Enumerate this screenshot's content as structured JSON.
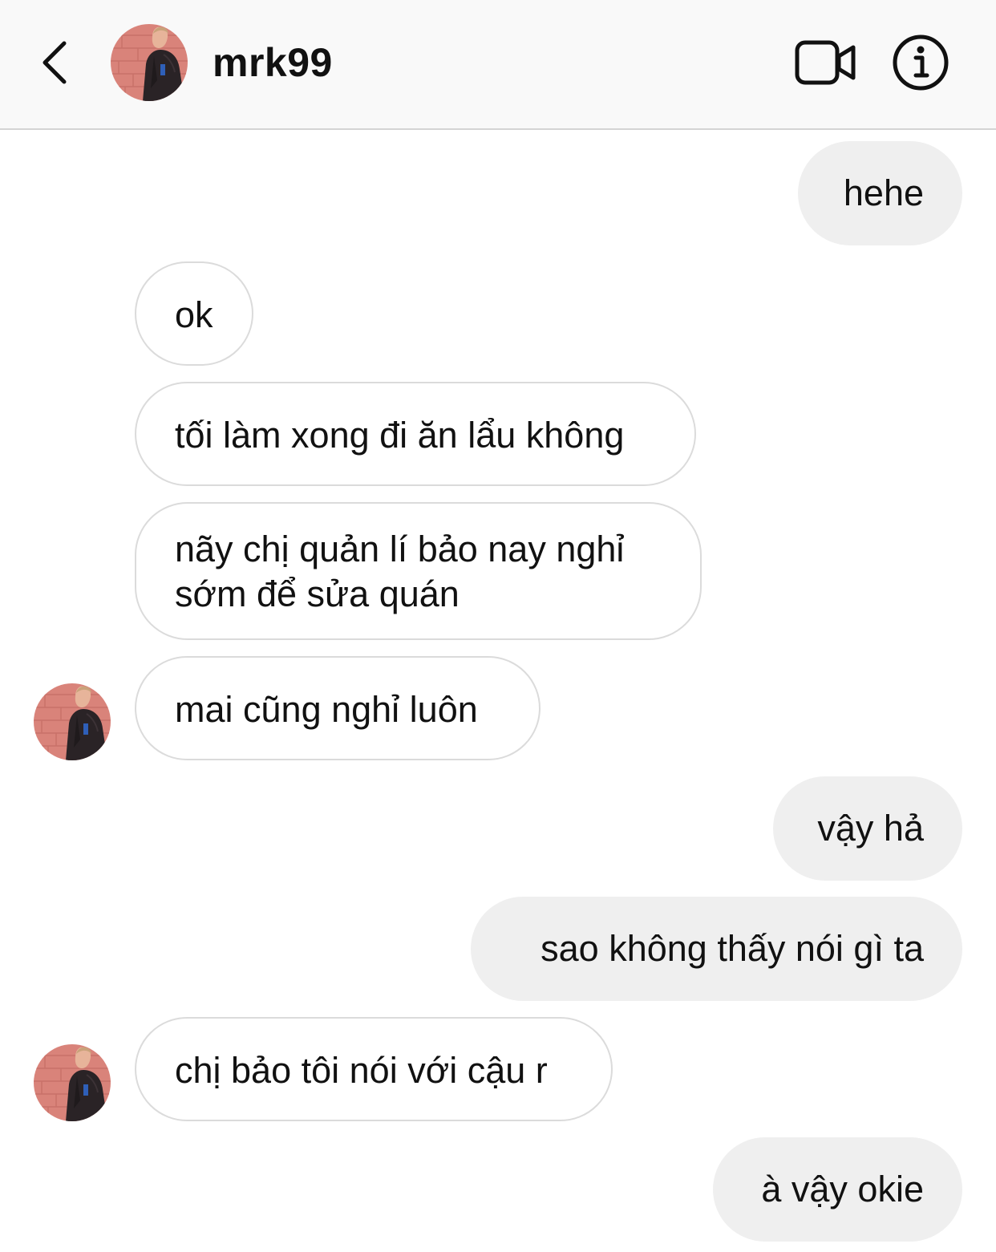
{
  "header": {
    "username": "mrk99",
    "back_icon": "chevron-left-icon",
    "video_icon": "video-camera-icon",
    "info_icon": "info-icon"
  },
  "messages": [
    {
      "from": "me",
      "text": "hehe"
    },
    {
      "from": "them",
      "text": "ok"
    },
    {
      "from": "them",
      "text": "tối làm xong đi ăn lẩu không"
    },
    {
      "from": "them",
      "text": "nãy chị quản lí bảo nay nghỉ sớm để sửa quán"
    },
    {
      "from": "them",
      "text": "mai cũng nghỉ luôn"
    },
    {
      "from": "me",
      "text": "vậy hả"
    },
    {
      "from": "me",
      "text": "sao không thấy nói gì ta"
    },
    {
      "from": "them",
      "text": "chị bảo tôi nói với cậu r"
    },
    {
      "from": "me",
      "text": "à vậy okie"
    }
  ],
  "colors": {
    "header_bg": "#f9f9f9",
    "outgoing_bubble": "#efefef",
    "incoming_border": "#dbdbdb",
    "text": "#111111"
  }
}
